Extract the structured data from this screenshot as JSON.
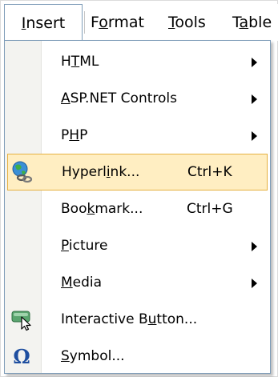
{
  "menubar": {
    "items": [
      {
        "prefix": "",
        "mnemonic": "I",
        "rest": "nsert"
      },
      {
        "prefix": "F",
        "mnemonic": "o",
        "rest": "rmat"
      },
      {
        "prefix": "",
        "mnemonic": "T",
        "rest": "ools"
      },
      {
        "prefix": "T",
        "mnemonic": "a",
        "rest": "ble"
      }
    ]
  },
  "menu": {
    "items": [
      {
        "pre": "H",
        "mn": "T",
        "post": "ML",
        "shortcut": "",
        "submenu": true,
        "icon": ""
      },
      {
        "pre": "",
        "mn": "A",
        "post": "SP.NET Controls",
        "shortcut": "",
        "submenu": true,
        "icon": ""
      },
      {
        "pre": "P",
        "mn": "H",
        "post": "P",
        "shortcut": "",
        "submenu": true,
        "icon": ""
      },
      {
        "pre": "Hyperl",
        "mn": "i",
        "post": "nk...",
        "shortcut": "Ctrl+K",
        "submenu": false,
        "icon": "hyperlink-globe-icon"
      },
      {
        "pre": "Boo",
        "mn": "k",
        "post": "mark...",
        "shortcut": "Ctrl+G",
        "submenu": false,
        "icon": ""
      },
      {
        "pre": "",
        "mn": "P",
        "post": "icture",
        "shortcut": "",
        "submenu": true,
        "icon": ""
      },
      {
        "pre": "",
        "mn": "M",
        "post": "edia",
        "shortcut": "",
        "submenu": true,
        "icon": ""
      },
      {
        "pre": "Interactive B",
        "mn": "u",
        "post": "tton...",
        "shortcut": "",
        "submenu": false,
        "icon": "interactive-button-icon"
      },
      {
        "pre": "",
        "mn": "S",
        "post": "ymbol...",
        "shortcut": "",
        "submenu": false,
        "icon": "omega-symbol-icon"
      }
    ]
  },
  "colors": {
    "highlight_fill": "#ffeec2",
    "highlight_border": "#e6b142",
    "icon_strip": "#f3f3f0",
    "menu_border": "#7f9db9"
  }
}
